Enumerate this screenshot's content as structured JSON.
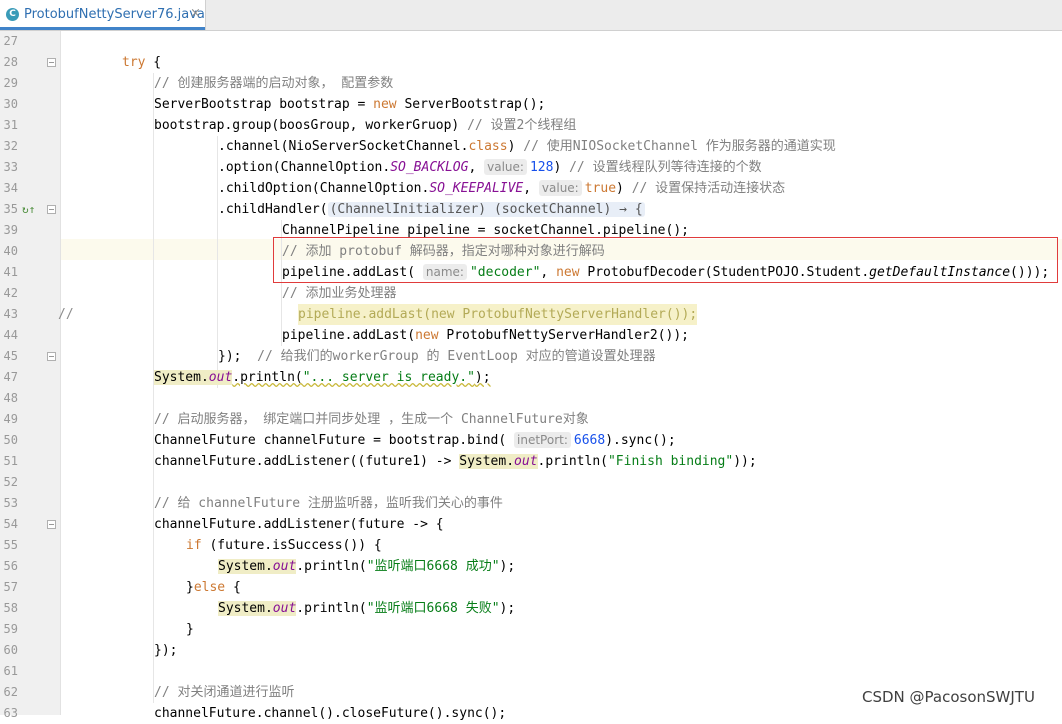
{
  "tab": {
    "icon": "java-class-icon",
    "icon_glyph": "C",
    "title": "ProtobufNettyServer76.java",
    "close": "×"
  },
  "lines": [
    {
      "n": "27"
    },
    {
      "n": "28"
    },
    {
      "n": "29"
    },
    {
      "n": "30"
    },
    {
      "n": "31"
    },
    {
      "n": "32"
    },
    {
      "n": "33"
    },
    {
      "n": "34"
    },
    {
      "n": "35"
    },
    {
      "n": "39"
    },
    {
      "n": "40"
    },
    {
      "n": "41"
    },
    {
      "n": "42"
    },
    {
      "n": "43"
    },
    {
      "n": "44"
    },
    {
      "n": "45"
    },
    {
      "n": "47"
    },
    {
      "n": "48"
    },
    {
      "n": "49"
    },
    {
      "n": "50"
    },
    {
      "n": "51"
    },
    {
      "n": "52"
    },
    {
      "n": "53"
    },
    {
      "n": "54"
    },
    {
      "n": "55"
    },
    {
      "n": "56"
    },
    {
      "n": "57"
    },
    {
      "n": "58"
    },
    {
      "n": "59"
    },
    {
      "n": "60"
    },
    {
      "n": "61"
    },
    {
      "n": "62"
    },
    {
      "n": "63"
    }
  ],
  "code": {
    "l28": {
      "kw": "try",
      "rest": " {"
    },
    "l29": "// 创建服务器端的启动对象， 配置参数",
    "l30a": "ServerBootstrap bootstrap = ",
    "l30kw": "new",
    "l30b": " ServerBootstrap();",
    "l31a": "bootstrap.group(boosGroup, workerGruop) ",
    "l31c": "// 设置2个线程组",
    "l32a": ".channel(NioServerSocketChannel.",
    "l32kw": "class",
    "l32b": ") ",
    "l32c": "// 使用NIOSocketChannel 作为服务器的通道实现",
    "l33a": ".option(ChannelOption.",
    "l33const": "SO_BACKLOG",
    "l33b": ", ",
    "l33hint": "value:",
    "l33num": "128",
    "l33c": ") ",
    "l33cm": "// 设置线程队列等待连接的个数",
    "l34a": ".childOption(ChannelOption.",
    "l34const": "SO_KEEPALIVE",
    "l34b": ", ",
    "l34hint": "value:",
    "l34kw": "true",
    "l34c": ") ",
    "l34cm": "// 设置保持活动连接状态",
    "l35a": ".childHandler(",
    "l35fold": "(ChannelInitializer) (socketChannel) → {",
    "l39": "ChannelPipeline pipeline = socketChannel.pipeline();",
    "l40": "// 添加 protobuf 解码器，指定对哪种对象进行解码",
    "l41a": "pipeline.addLast( ",
    "l41hint": "name:",
    "l41str": "\"decoder\"",
    "l41b": ", ",
    "l41kw": "new",
    "l41c": " ProtobufDecoder(StudentPOJO.Student.",
    "l41it": "getDefaultInstance",
    "l41d": "()));",
    "l42": "// 添加业务处理器",
    "l43slash": "//",
    "l43a": "pipeline.addLast(",
    "l43kw": "new",
    "l43b": " ProtobufNettyServerHandler());",
    "l44a": "pipeline.addLast(",
    "l44kw": "new",
    "l44b": " ProtobufNettyServerHandler2());",
    "l45a": "});  ",
    "l45c": "// 给我们的workerGroup 的 EventLoop 对应的管道设置处理器",
    "l47a": "System.",
    "l47out": "out",
    "l47b": ".println(",
    "l47str": "\"... server is ready.\"",
    "l47c": ");",
    "l49": "// 启动服务器， 绑定端口并同步处理 ，生成一个 ChannelFuture对象",
    "l50a": "ChannelFuture channelFuture = bootstrap.bind( ",
    "l50hint": "inetPort:",
    "l50num": "6668",
    "l50b": ").sync();",
    "l51a": "channelFuture.addListener((future1) -> ",
    "l51sys": "System.",
    "l51out": "out",
    "l51b": ".println(",
    "l51str": "\"Finish binding\"",
    "l51c": "));",
    "l53": "// 给 channelFuture 注册监听器，监听我们关心的事件",
    "l54": "channelFuture.addListener(future -> {",
    "l55kw": "if",
    "l55b": " (future.isSuccess()) {",
    "l56a": "System.",
    "l56out": "out",
    "l56b": ".println(",
    "l56str": "\"监听端口6668 成功\"",
    "l56c": ");",
    "l57a": "}",
    "l57kw": "else",
    "l57b": " {",
    "l58a": "System.",
    "l58out": "out",
    "l58b": ".println(",
    "l58str": "\"监听端口6668 失败\"",
    "l58c": ");",
    "l59": "}",
    "l60": "});",
    "l62": "// 对关闭通道进行监听",
    "l63": "channelFuture.channel().closeFuture().sync();"
  },
  "gutter_icons": {
    "l35": "↻↑"
  },
  "watermark": "CSDN @PacosonSWJTU"
}
